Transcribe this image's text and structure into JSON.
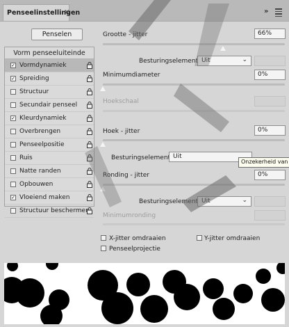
{
  "tab": {
    "title": "Penseelinstellingen",
    "close": "×"
  },
  "toolbar": {
    "collapse": "»",
    "menu_icon": "menu-icon"
  },
  "brushes_button": "Penselen",
  "list": {
    "header": "Vorm penseeluiteinde",
    "items": [
      {
        "label": "Vormdynamiek",
        "checked": true,
        "selected": true
      },
      {
        "label": "Spreiding",
        "checked": true
      },
      {
        "label": "Structuur",
        "checked": false
      },
      {
        "label": "Secundair penseel",
        "checked": false
      },
      {
        "label": "Kleurdynamiek",
        "checked": true
      },
      {
        "label": "Overbrengen",
        "checked": false
      },
      {
        "label": "Penseelpositie",
        "checked": false
      },
      {
        "label": "Ruis",
        "checked": false
      },
      {
        "label": "Natte randen",
        "checked": false
      },
      {
        "label": "Opbouwen",
        "checked": false
      },
      {
        "label": "Vloeiend maken",
        "checked": true
      },
      {
        "label": "Structuur beschermen",
        "checked": false
      }
    ]
  },
  "size_jitter": {
    "label": "Grootte - jitter",
    "value": "66%",
    "level": 0.66
  },
  "control1": {
    "label": "Besturingselement:",
    "value": "Uit"
  },
  "min_diameter": {
    "label": "Minimumdiameter",
    "value": "0%",
    "level": 0
  },
  "tilt_scale": {
    "label": "Hoekschaal"
  },
  "angle_jitter": {
    "label": "Hoek - jitter",
    "value": "0%",
    "level": 0
  },
  "control2": {
    "label": "Besturingselement:",
    "value": "Uit"
  },
  "tooltip": "Onzekerheid van",
  "roundness_jitter": {
    "label": "Ronding - jitter",
    "value": "0%",
    "level": 0
  },
  "control3": {
    "label": "Besturingselement:",
    "value": "Uit"
  },
  "min_roundness": {
    "label": "Minimumronding"
  },
  "options": {
    "flip_x": "X-jitter omdraaien",
    "flip_y": "Y-jitter omdraaien",
    "projection": "Penseelprojectie"
  },
  "colors": {
    "panel": "#d6d6d6",
    "selected": "#b8b8b8",
    "preview": "#ffffff",
    "stroke": "#000000"
  }
}
